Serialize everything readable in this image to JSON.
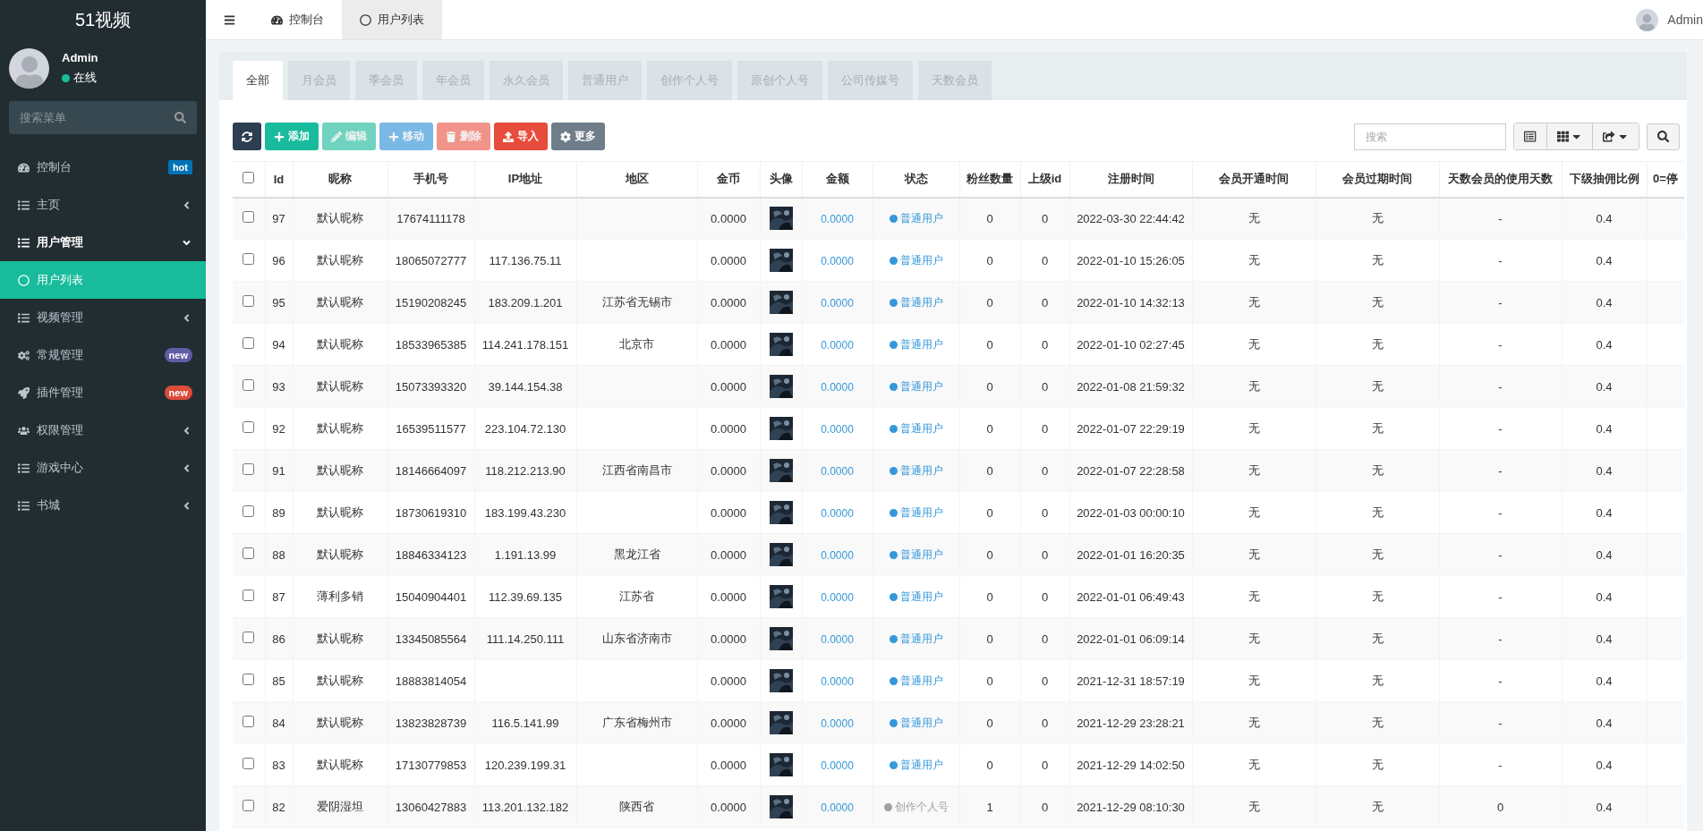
{
  "brand": "51视频",
  "user": {
    "name": "Admin",
    "status": "在线",
    "online": true
  },
  "menu_search": {
    "placeholder": "搜索菜单"
  },
  "menu": [
    {
      "label": "控制台",
      "kind": "dashboard",
      "badge": {
        "text": "hot",
        "color": "#0073b7"
      }
    },
    {
      "label": "主页",
      "kind": "list",
      "expanded": false
    },
    {
      "label": "用户管理",
      "kind": "list",
      "expanded": true,
      "children": [
        {
          "label": "用户列表",
          "kind": "circle",
          "selected": true
        }
      ]
    },
    {
      "label": "视频管理",
      "kind": "list",
      "expanded": false
    },
    {
      "label": "常规管理",
      "kind": "cogs",
      "badge": {
        "text": "new",
        "color": "#605ca8"
      }
    },
    {
      "label": "插件管理",
      "kind": "rocket",
      "badge": {
        "text": "new",
        "color": "#dd4b39"
      }
    },
    {
      "label": "权限管理",
      "kind": "users",
      "expanded": false
    },
    {
      "label": "游戏中心",
      "kind": "list",
      "expanded": false
    },
    {
      "label": "书城",
      "kind": "list",
      "expanded": false
    }
  ],
  "top_tabs": [
    {
      "label": "控制台",
      "kind": "dashboard",
      "selected": false
    },
    {
      "label": "用户列表",
      "kind": "circle",
      "selected": true
    }
  ],
  "top_user": "Admin",
  "filter_tabs": [
    {
      "label": "全部",
      "selected": true
    },
    {
      "label": "月会员",
      "selected": false
    },
    {
      "label": "季会员",
      "selected": false
    },
    {
      "label": "年会员",
      "selected": false
    },
    {
      "label": "永久会员",
      "selected": false
    },
    {
      "label": "普通用户",
      "selected": false
    },
    {
      "label": "创作个人号",
      "selected": false
    },
    {
      "label": "原创个人号",
      "selected": false
    },
    {
      "label": "公司传媒号",
      "selected": false
    },
    {
      "label": "天数会员",
      "selected": false
    }
  ],
  "actions": [
    {
      "kind": "refresh",
      "color": "#2c3e50",
      "disabled": false
    },
    {
      "label": "添加",
      "kind": "plus",
      "color": "#18bc9c",
      "disabled": false
    },
    {
      "label": "编辑",
      "kind": "pencil",
      "color": "#6fd3bf",
      "disabled": true
    },
    {
      "label": "移动",
      "kind": "plus",
      "color": "#7ab8e6",
      "disabled": true
    },
    {
      "label": "删除",
      "kind": "trash",
      "color": "#f1938a",
      "disabled": true
    },
    {
      "label": "导入",
      "kind": "upload",
      "color": "#e74c3c",
      "disabled": false
    },
    {
      "label": "更多",
      "kind": "cog",
      "color": "#6f7d8a",
      "disabled": false
    }
  ],
  "select_all": {
    "checked": false
  },
  "table_search": {
    "placeholder": "搜索"
  },
  "columns": [
    "Id",
    "昵称",
    "手机号",
    "IP地址",
    "地区",
    "金币",
    "头像",
    "金额",
    "状态",
    "粉丝数量",
    "上级id",
    "注册时间",
    "会员开通时间",
    "会员过期时间",
    "天数会员的使用天数",
    "下级抽佣比例",
    "0=停"
  ],
  "rows": [
    {
      "checked": false,
      "id": "97",
      "nickname": "默认昵称",
      "phone": "17674111178",
      "coins": "0.0000",
      "amount": "0.0000",
      "status": {
        "text": "普通用户",
        "color": "#3498db"
      },
      "fans": "0",
      "parent_id": "0",
      "registered": "2022-03-30 22:44:42",
      "vip_start": "无",
      "vip_end": "无",
      "days_used": "-",
      "commission": "0.4"
    },
    {
      "checked": false,
      "id": "96",
      "nickname": "默认昵称",
      "phone": "18065072777",
      "ip": "117.136.75.11",
      "coins": "0.0000",
      "amount": "0.0000",
      "status": {
        "text": "普通用户",
        "color": "#3498db"
      },
      "fans": "0",
      "parent_id": "0",
      "registered": "2022-01-10 15:26:05",
      "vip_start": "无",
      "vip_end": "无",
      "days_used": "-",
      "commission": "0.4"
    },
    {
      "checked": false,
      "id": "95",
      "nickname": "默认昵称",
      "phone": "15190208245",
      "ip": "183.209.1.201",
      "region": "江苏省无锡市",
      "coins": "0.0000",
      "amount": "0.0000",
      "status": {
        "text": "普通用户",
        "color": "#3498db"
      },
      "fans": "0",
      "parent_id": "0",
      "registered": "2022-01-10 14:32:13",
      "vip_start": "无",
      "vip_end": "无",
      "days_used": "-",
      "commission": "0.4"
    },
    {
      "checked": false,
      "id": "94",
      "nickname": "默认昵称",
      "phone": "18533965385",
      "ip": "114.241.178.151",
      "region": "北京市",
      "coins": "0.0000",
      "amount": "0.0000",
      "status": {
        "text": "普通用户",
        "color": "#3498db"
      },
      "fans": "0",
      "parent_id": "0",
      "registered": "2022-01-10 02:27:45",
      "vip_start": "无",
      "vip_end": "无",
      "days_used": "-",
      "commission": "0.4"
    },
    {
      "checked": false,
      "id": "93",
      "nickname": "默认昵称",
      "phone": "15073393320",
      "ip": "39.144.154.38",
      "coins": "0.0000",
      "amount": "0.0000",
      "status": {
        "text": "普通用户",
        "color": "#3498db"
      },
      "fans": "0",
      "parent_id": "0",
      "registered": "2022-01-08 21:59:32",
      "vip_start": "无",
      "vip_end": "无",
      "days_used": "-",
      "commission": "0.4"
    },
    {
      "checked": false,
      "id": "92",
      "nickname": "默认昵称",
      "phone": "16539511577",
      "ip": "223.104.72.130",
      "coins": "0.0000",
      "amount": "0.0000",
      "status": {
        "text": "普通用户",
        "color": "#3498db"
      },
      "fans": "0",
      "parent_id": "0",
      "registered": "2022-01-07 22:29:19",
      "vip_start": "无",
      "vip_end": "无",
      "days_used": "-",
      "commission": "0.4"
    },
    {
      "checked": false,
      "id": "91",
      "nickname": "默认昵称",
      "phone": "18146664097",
      "ip": "118.212.213.90",
      "region": "江西省南昌市",
      "coins": "0.0000",
      "amount": "0.0000",
      "status": {
        "text": "普通用户",
        "color": "#3498db"
      },
      "fans": "0",
      "parent_id": "0",
      "registered": "2022-01-07 22:28:58",
      "vip_start": "无",
      "vip_end": "无",
      "days_used": "-",
      "commission": "0.4"
    },
    {
      "checked": false,
      "id": "89",
      "nickname": "默认昵称",
      "phone": "18730619310",
      "ip": "183.199.43.230",
      "coins": "0.0000",
      "amount": "0.0000",
      "status": {
        "text": "普通用户",
        "color": "#3498db"
      },
      "fans": "0",
      "parent_id": "0",
      "registered": "2022-01-03 00:00:10",
      "vip_start": "无",
      "vip_end": "无",
      "days_used": "-",
      "commission": "0.4"
    },
    {
      "checked": false,
      "id": "88",
      "nickname": "默认昵称",
      "phone": "18846334123",
      "ip": "1.191.13.99",
      "region": "黑龙江省",
      "coins": "0.0000",
      "amount": "0.0000",
      "status": {
        "text": "普通用户",
        "color": "#3498db"
      },
      "fans": "0",
      "parent_id": "0",
      "registered": "2022-01-01 16:20:35",
      "vip_start": "无",
      "vip_end": "无",
      "days_used": "-",
      "commission": "0.4"
    },
    {
      "checked": false,
      "id": "87",
      "nickname": "薄利多销",
      "phone": "15040904401",
      "ip": "112.39.69.135",
      "region": "江苏省",
      "coins": "0.0000",
      "amount": "0.0000",
      "status": {
        "text": "普通用户",
        "color": "#3498db"
      },
      "fans": "0",
      "parent_id": "0",
      "registered": "2022-01-01 06:49:43",
      "vip_start": "无",
      "vip_end": "无",
      "days_used": "-",
      "commission": "0.4"
    },
    {
      "checked": false,
      "id": "86",
      "nickname": "默认昵称",
      "phone": "13345085564",
      "ip": "111.14.250.111",
      "region": "山东省济南市",
      "coins": "0.0000",
      "amount": "0.0000",
      "status": {
        "text": "普通用户",
        "color": "#3498db"
      },
      "fans": "0",
      "parent_id": "0",
      "registered": "2022-01-01 06:09:14",
      "vip_start": "无",
      "vip_end": "无",
      "days_used": "-",
      "commission": "0.4"
    },
    {
      "checked": false,
      "id": "85",
      "nickname": "默认昵称",
      "phone": "18883814054",
      "coins": "0.0000",
      "amount": "0.0000",
      "status": {
        "text": "普通用户",
        "color": "#3498db"
      },
      "fans": "0",
      "parent_id": "0",
      "registered": "2021-12-31 18:57:19",
      "vip_start": "无",
      "vip_end": "无",
      "days_used": "-",
      "commission": "0.4"
    },
    {
      "checked": false,
      "id": "84",
      "nickname": "默认昵称",
      "phone": "13823828739",
      "ip": "116.5.141.99",
      "region": "广东省梅州市",
      "coins": "0.0000",
      "amount": "0.0000",
      "status": {
        "text": "普通用户",
        "color": "#3498db"
      },
      "fans": "0",
      "parent_id": "0",
      "registered": "2021-12-29 23:28:21",
      "vip_start": "无",
      "vip_end": "无",
      "days_used": "-",
      "commission": "0.4"
    },
    {
      "checked": false,
      "id": "83",
      "nickname": "默认昵称",
      "phone": "17130779853",
      "ip": "120.239.199.31",
      "coins": "0.0000",
      "amount": "0.0000",
      "status": {
        "text": "普通用户",
        "color": "#3498db"
      },
      "fans": "0",
      "parent_id": "0",
      "registered": "2021-12-29 14:02:50",
      "vip_start": "无",
      "vip_end": "无",
      "days_used": "-",
      "commission": "0.4"
    },
    {
      "checked": false,
      "id": "82",
      "nickname": "爱阴湿坦",
      "phone": "13060427883",
      "ip": "113.201.132.182",
      "region": "陕西省",
      "coins": "0.0000",
      "amount": "0.0000",
      "status": {
        "text": "创作个人号",
        "color": "#a0a0a0"
      },
      "fans": "1",
      "parent_id": "0",
      "registered": "2021-12-29 08:10:30",
      "vip_start": "无",
      "vip_end": "无",
      "days_used": "0",
      "commission": "0.4"
    }
  ]
}
